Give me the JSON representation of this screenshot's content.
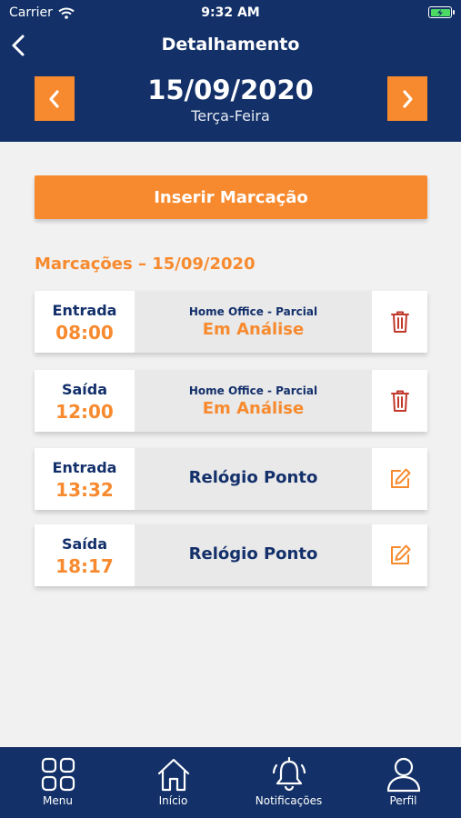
{
  "status_bar": {
    "carrier": "Carrier",
    "time": "9:32 AM"
  },
  "header": {
    "title": "Detalhamento",
    "date": "15/09/2020",
    "weekday": "Terça-Feira"
  },
  "actions": {
    "insert_label": "Inserir Marcação"
  },
  "section": {
    "title": "Marcações – 15/09/2020"
  },
  "entries": [
    {
      "type": "Entrada",
      "time": "08:00",
      "source": "Home Office - Parcial",
      "status": "Em Análise",
      "action_icon": "trash-icon"
    },
    {
      "type": "Saída",
      "time": "12:00",
      "source": "Home Office - Parcial",
      "status": "Em Análise",
      "action_icon": "trash-icon"
    },
    {
      "type": "Entrada",
      "time": "13:32",
      "source": "Relógio Ponto",
      "status": "",
      "action_icon": "edit-icon"
    },
    {
      "type": "Saída",
      "time": "18:17",
      "source": "Relógio Ponto",
      "status": "",
      "action_icon": "edit-icon"
    }
  ],
  "tabbar": {
    "items": [
      {
        "label": "Menu",
        "icon": "grid-menu-icon"
      },
      {
        "label": "Início",
        "icon": "home-icon"
      },
      {
        "label": "Notificações",
        "icon": "bell-icon"
      },
      {
        "label": "Perfil",
        "icon": "user-icon"
      }
    ]
  },
  "colors": {
    "navy": "#133168",
    "orange": "#f78a2e",
    "background": "#f1f1f1",
    "delete_red": "#c0392b"
  }
}
